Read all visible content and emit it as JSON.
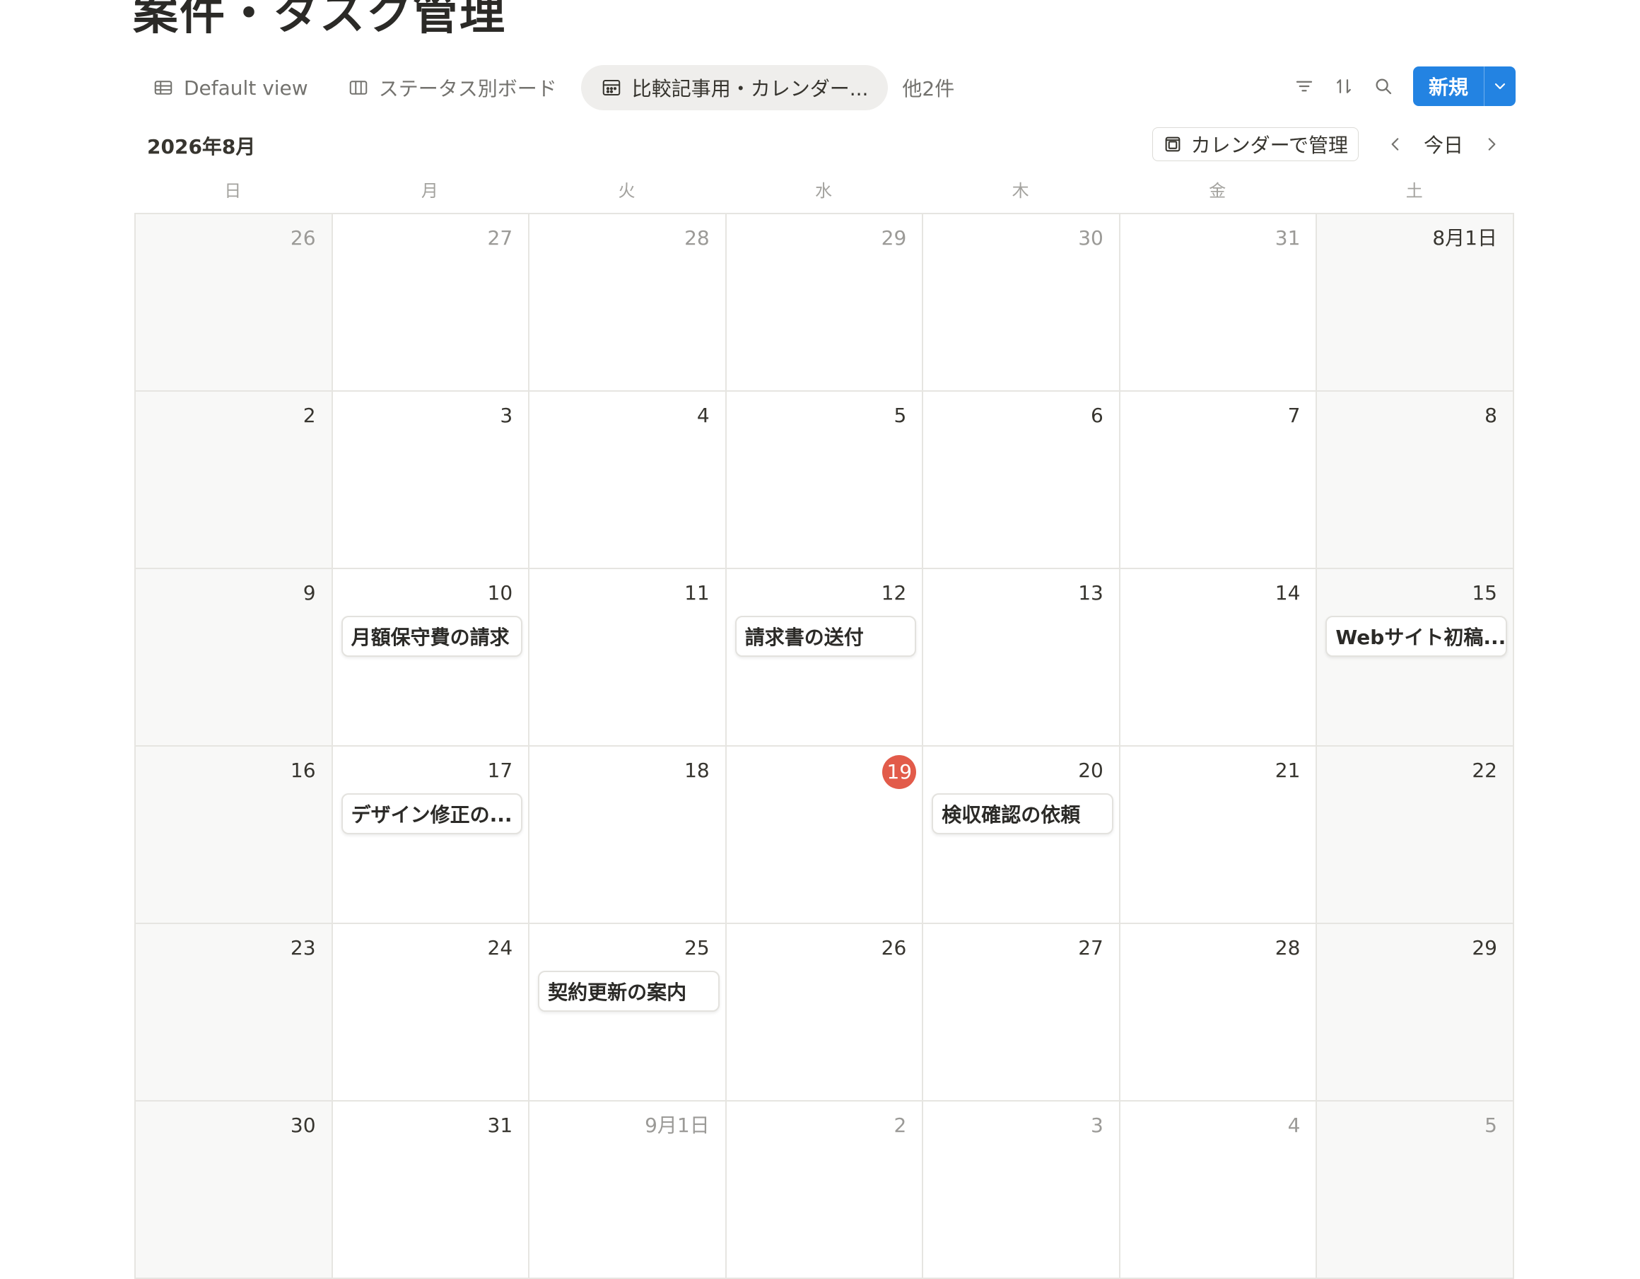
{
  "page": {
    "title": "案件・タスク管理"
  },
  "views": {
    "tabs": [
      {
        "label": "Default view",
        "icon": "table-icon"
      },
      {
        "label": "ステータス別ボード",
        "icon": "board-icon"
      },
      {
        "label": "比較記事用・カレンダー...",
        "icon": "calendar-icon",
        "active": true
      }
    ],
    "more_label": "他2件"
  },
  "toolbar": {
    "new_label": "新規",
    "accent_color": "#2383e2"
  },
  "calendar": {
    "month_label": "2026年8月",
    "manage_button_label": "カレンダーで管理",
    "today_label": "今日",
    "weekdays": [
      "日",
      "月",
      "火",
      "水",
      "木",
      "金",
      "土"
    ],
    "today_color": "#e25b4a",
    "days": [
      {
        "label": "26",
        "muted": true
      },
      {
        "label": "27",
        "muted": true
      },
      {
        "label": "28",
        "muted": true
      },
      {
        "label": "29",
        "muted": true
      },
      {
        "label": "30",
        "muted": true
      },
      {
        "label": "31",
        "muted": true
      },
      {
        "label": "8月1日"
      },
      {
        "label": "2"
      },
      {
        "label": "3"
      },
      {
        "label": "4"
      },
      {
        "label": "5"
      },
      {
        "label": "6"
      },
      {
        "label": "7"
      },
      {
        "label": "8"
      },
      {
        "label": "9"
      },
      {
        "label": "10",
        "event": "月額保守費の請求"
      },
      {
        "label": "11"
      },
      {
        "label": "12",
        "event": "請求書の送付"
      },
      {
        "label": "13"
      },
      {
        "label": "14"
      },
      {
        "label": "15",
        "event": "Webサイト初稿..."
      },
      {
        "label": "16"
      },
      {
        "label": "17",
        "event": "デザイン修正の..."
      },
      {
        "label": "18"
      },
      {
        "label": "19",
        "today": true
      },
      {
        "label": "20",
        "event": "検収確認の依頼"
      },
      {
        "label": "21"
      },
      {
        "label": "22"
      },
      {
        "label": "23"
      },
      {
        "label": "24"
      },
      {
        "label": "25",
        "event": "契約更新の案内"
      },
      {
        "label": "26"
      },
      {
        "label": "27"
      },
      {
        "label": "28"
      },
      {
        "label": "29"
      },
      {
        "label": "30"
      },
      {
        "label": "31"
      },
      {
        "label": "9月1日",
        "muted": true
      },
      {
        "label": "2",
        "muted": true
      },
      {
        "label": "3",
        "muted": true
      },
      {
        "label": "4",
        "muted": true
      },
      {
        "label": "5",
        "muted": true
      }
    ]
  }
}
